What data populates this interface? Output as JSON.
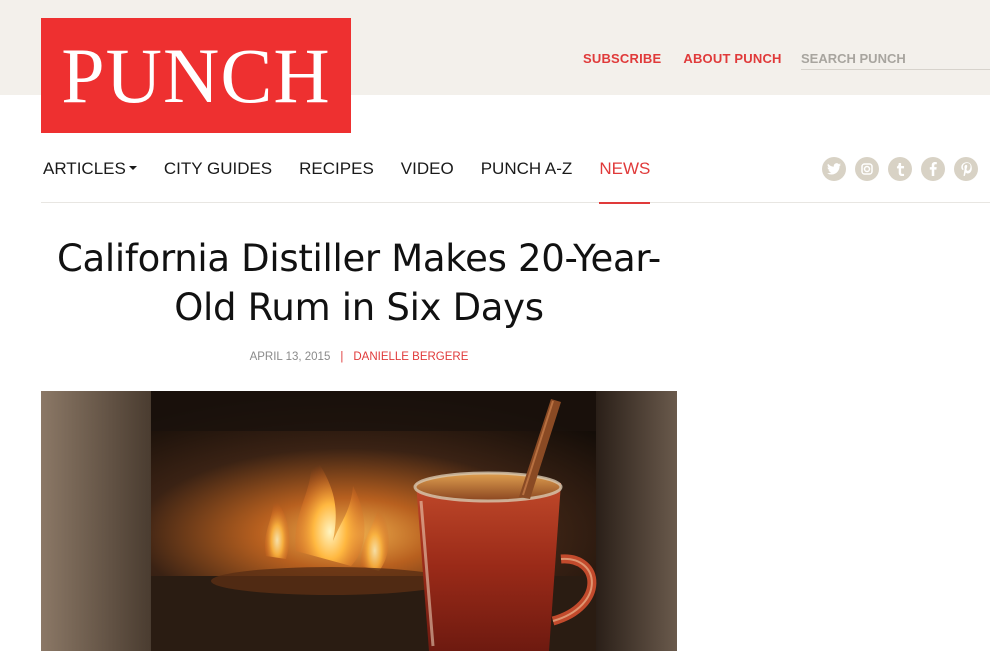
{
  "site": {
    "logo_text": "PUNCH",
    "brand_color": "#ee3030"
  },
  "utility": {
    "subscribe_label": "SUBSCRIBE",
    "about_label": "ABOUT PUNCH",
    "search_placeholder": "SEARCH PUNCH"
  },
  "nav": {
    "items": [
      {
        "label": "ARTICLES",
        "has_dropdown": true
      },
      {
        "label": "CITY GUIDES"
      },
      {
        "label": "RECIPES"
      },
      {
        "label": "VIDEO"
      },
      {
        "label": "PUNCH A-Z"
      },
      {
        "label": "NEWS",
        "active": true
      }
    ]
  },
  "social": {
    "icons": [
      {
        "name": "twitter-icon",
        "glyph": "t"
      },
      {
        "name": "instagram-icon",
        "glyph": "◎"
      },
      {
        "name": "tumblr-icon",
        "glyph": "t"
      },
      {
        "name": "facebook-icon",
        "glyph": "f"
      },
      {
        "name": "pinterest-icon",
        "glyph": "p"
      }
    ]
  },
  "article": {
    "title": "California Distiller Makes 20-Year-Old Rum in Six Days",
    "date": "APRIL 13, 2015",
    "separator": "|",
    "author": "DANIELLE BERGERE",
    "hero_image": "mug-of-hot-buttered-rum-with-cinnamon-stick-by-fireplace"
  }
}
